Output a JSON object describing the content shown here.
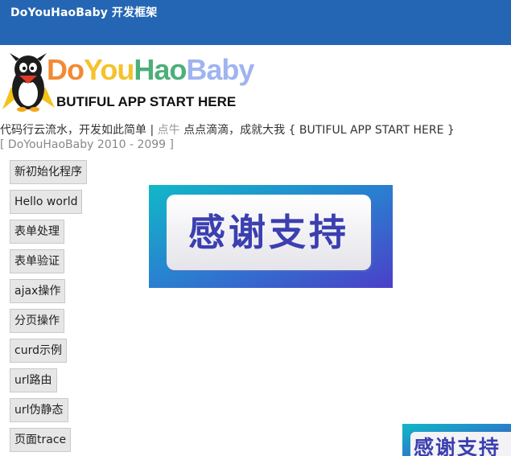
{
  "header": {
    "title": "DoYouHaoBaby 开发框架"
  },
  "logo": {
    "brand_letters": [
      "Do",
      "You",
      "Hao",
      "Baby"
    ],
    "brand_colors": [
      "#f28a33",
      "#f5c22b",
      "#4caf7a",
      "#9fb4f0"
    ],
    "slogan": "BUTIFUL APP START HERE"
  },
  "tagline": {
    "part1": "代码行云流水，开发如此简单 | ",
    "highlight": "点牛",
    "part2": " 点点滴滴，成就大我 { BUTIFUL APP START HERE }"
  },
  "copyright": "[ DoYouHaoBaby 2010 - 2099 ]",
  "menu": {
    "items": [
      {
        "label": "新初始化程序"
      },
      {
        "label": "Hello world"
      },
      {
        "label": "表单处理"
      },
      {
        "label": "表单验证"
      },
      {
        "label": "ajax操作"
      },
      {
        "label": "分页操作"
      },
      {
        "label": "curd示例"
      },
      {
        "label": "url路由"
      },
      {
        "label": "url伪静态"
      },
      {
        "label": "页面trace"
      }
    ]
  },
  "banner": {
    "text": "感谢支持"
  },
  "colors": {
    "header_bg": "#2466b3",
    "banner_text": "#3b3fb0",
    "button_bg": "#e6e6e6"
  }
}
